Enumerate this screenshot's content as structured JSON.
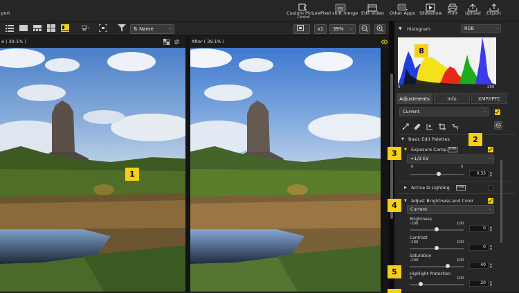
{
  "toolbar": {
    "export_partial": "port",
    "custom_picture_control": "Custom Picture",
    "custom_picture_control_sub": "Control",
    "pixel_shift": "Pixel shift merge",
    "edit_video": "Edit Video",
    "other_apps": "Other Apps",
    "slideshow": "Slideshow",
    "print": "Print",
    "upload": "Upload",
    "export": "Export"
  },
  "secondary": {
    "sort_label": "Name",
    "zoom_x1": "x1",
    "zoom_level": "39%"
  },
  "viewer": {
    "before_title": "e ( 39.1% )",
    "after_title": "After ( 39.1% )"
  },
  "panel": {
    "histogram_title": "Histogram",
    "histogram_channel": "RGB",
    "hist_min": "0",
    "hist_max": "255",
    "tabs": [
      "Adjustments",
      "Info",
      "XMP/IPTC"
    ],
    "preset": "Current",
    "basic_edit": "Basic Edit Palettes",
    "exposure_title": "Exposure Comp.",
    "exposure_value": "+1/3 EV",
    "exp_min": "-5",
    "exp_max": "5",
    "exp_field": "0.33",
    "dlighting": "Active D-Lighting",
    "abc_title": "Adjust Brightness and Color",
    "abc_preset": "Current",
    "brightness": "Brightness",
    "contrast": "Contrast",
    "saturation": "Saturation",
    "highlight": "Highlight Protection",
    "neg100": "-100",
    "pos100": "100",
    "zero": "0",
    "brightness_val": "0",
    "contrast_val": "0",
    "saturation_val": "40",
    "highlight_val": "20",
    "highlight_max": "100"
  },
  "sliders": {
    "exposure": 0.533,
    "brightness": 0.5,
    "contrast": 0.5,
    "saturation": 0.7,
    "highlight": 0.2
  },
  "badges": [
    "1",
    "2",
    "3",
    "4",
    "5",
    "8"
  ],
  "colors": {
    "accent": "#f5cf18"
  }
}
